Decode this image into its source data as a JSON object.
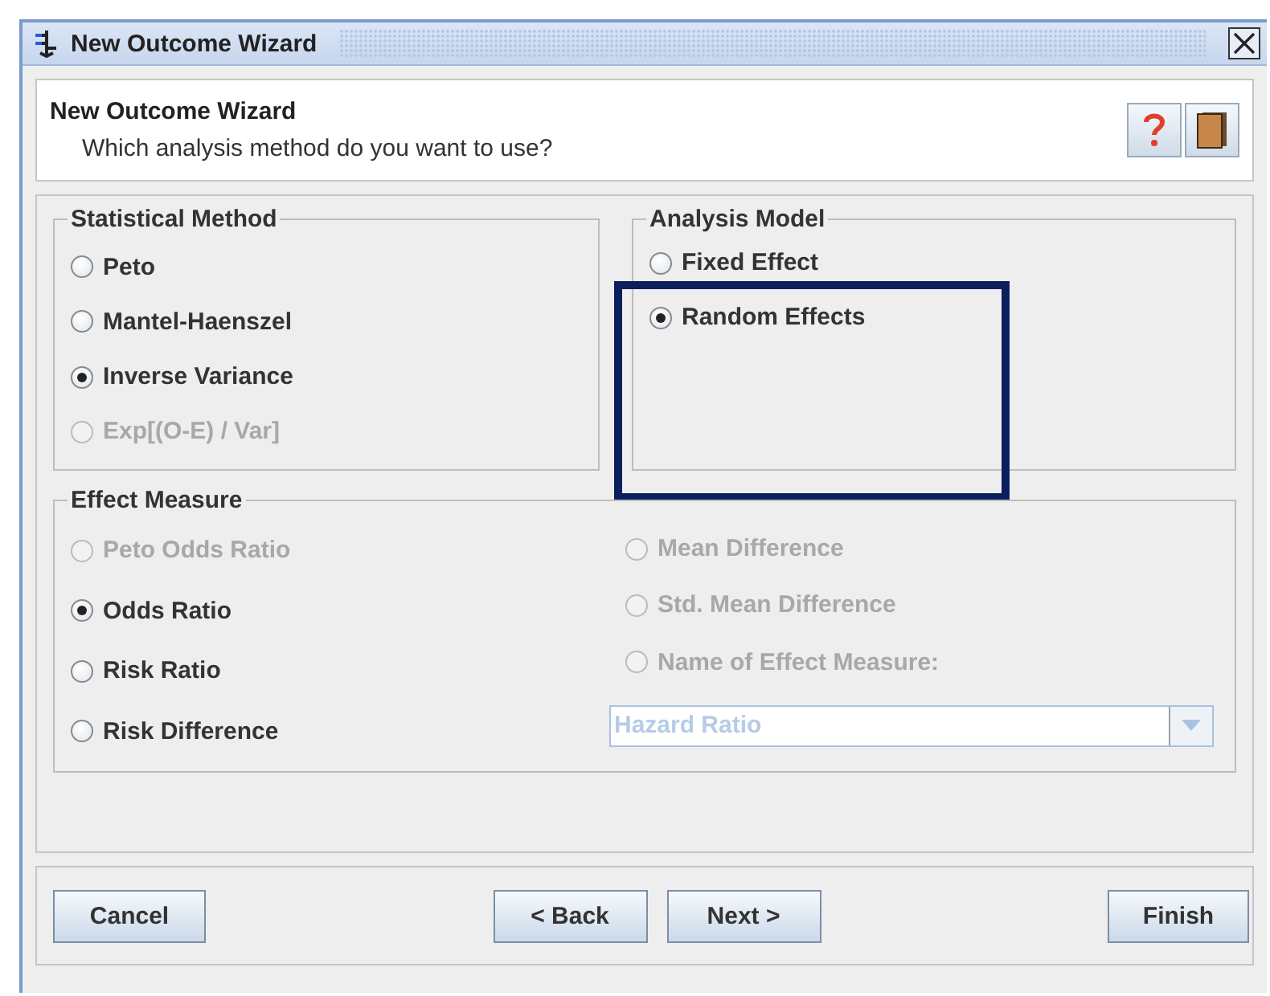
{
  "window": {
    "title": "New Outcome Wizard"
  },
  "header": {
    "title": "New Outcome Wizard",
    "subtitle": "Which analysis method do you want to use?"
  },
  "statistical_method": {
    "title": "Statistical Method",
    "options": [
      {
        "label": "Peto",
        "selected": false,
        "disabled": false
      },
      {
        "label": "Mantel-Haenszel",
        "selected": false,
        "disabled": false
      },
      {
        "label": "Inverse Variance",
        "selected": true,
        "disabled": false
      },
      {
        "label": "Exp[(O-E) / Var]",
        "selected": false,
        "disabled": true
      }
    ]
  },
  "analysis_model": {
    "title": "Analysis Model",
    "options": [
      {
        "label": "Fixed Effect",
        "selected": false,
        "disabled": false,
        "highlighted": false
      },
      {
        "label": "Random Effects",
        "selected": true,
        "disabled": false,
        "highlighted": true
      }
    ]
  },
  "effect_measure": {
    "title": "Effect Measure",
    "left": [
      {
        "kind": "radio",
        "label": "Peto Odds Ratio",
        "selected": false,
        "disabled": true
      },
      {
        "kind": "radio",
        "label": "Odds Ratio",
        "selected": true,
        "disabled": false
      },
      {
        "kind": "radio",
        "label": "Risk Ratio",
        "selected": false,
        "disabled": false
      },
      {
        "kind": "radio",
        "label": "Risk Difference",
        "selected": false,
        "disabled": false
      }
    ],
    "right": [
      {
        "kind": "radio",
        "label": "Mean Difference",
        "selected": false,
        "disabled": true
      },
      {
        "kind": "radio",
        "label": "Std. Mean Difference",
        "selected": false,
        "disabled": true
      },
      {
        "kind": "radio",
        "label": "Name of Effect Measure:",
        "selected": false,
        "disabled": true
      },
      {
        "kind": "combo",
        "value": "Hazard Ratio",
        "disabled": true
      }
    ]
  },
  "buttons": [
    {
      "label": "Cancel",
      "kind": "left"
    },
    {
      "label": "< Back",
      "kind": "middle"
    },
    {
      "label": "Next >",
      "kind": "middle"
    },
    {
      "label": "Finish",
      "kind": "right"
    }
  ]
}
